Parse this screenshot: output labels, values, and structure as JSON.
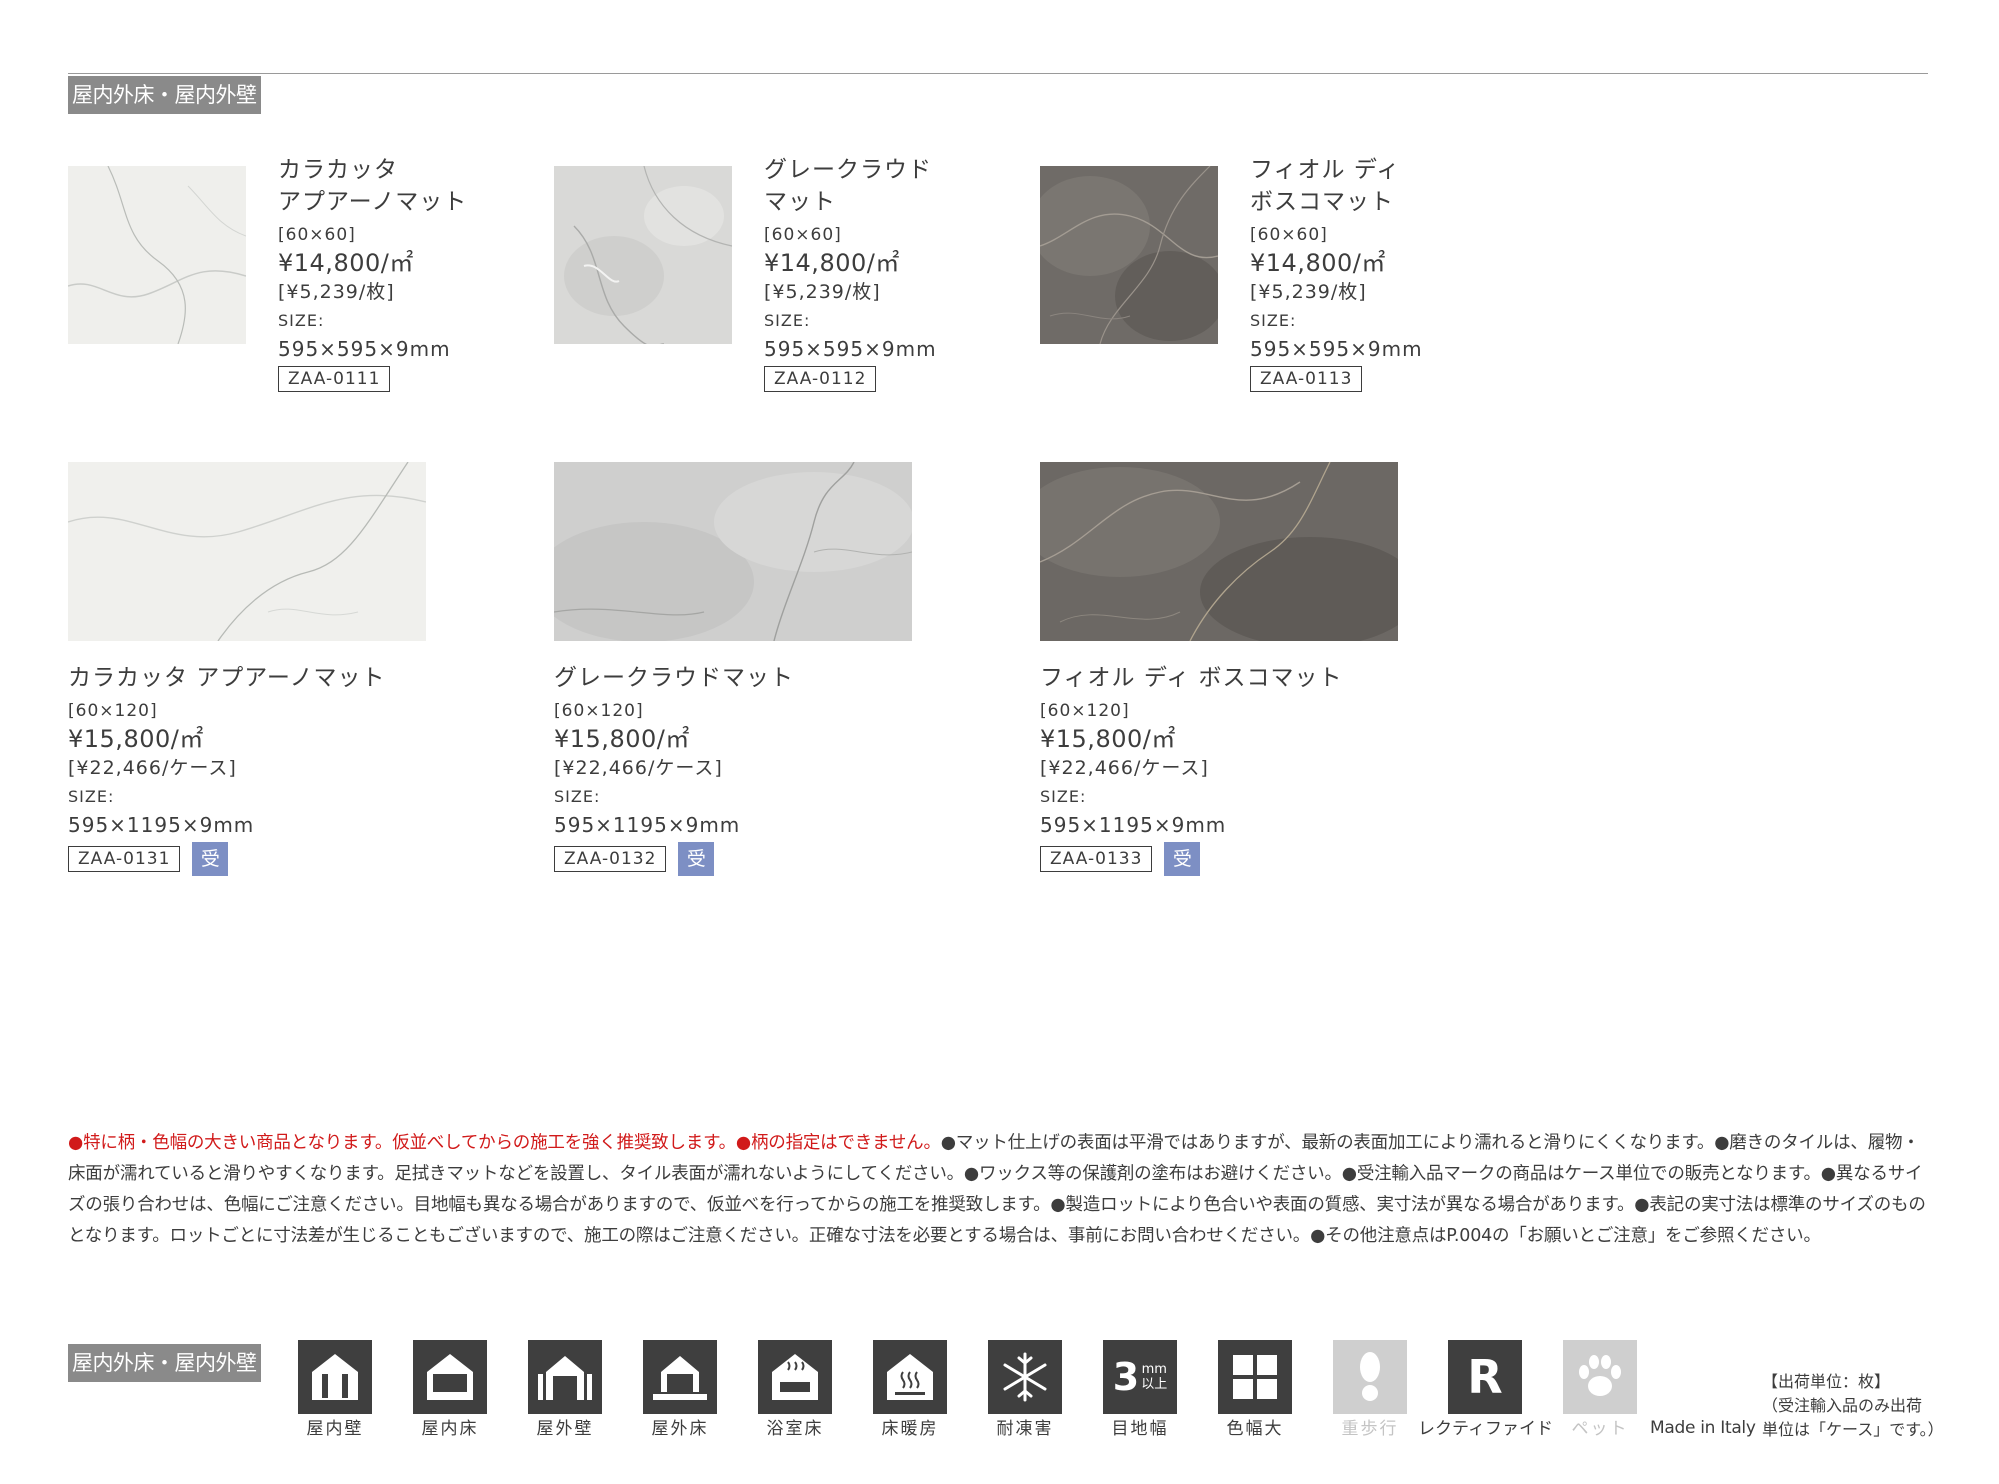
{
  "section_tag": "屋内外床・屋内外壁",
  "products_small": [
    {
      "name_line1": "カラカッタ",
      "name_line2": "アプアーノマット",
      "size_label": "[60×60]",
      "price": "¥14,800/㎡",
      "unit_price": "[¥5,239/枚]",
      "size_heading": "SIZE:",
      "dimensions": "595×595×9mm",
      "code": "ZAA-0111"
    },
    {
      "name_line1": "グレークラウド",
      "name_line2": "マット",
      "size_label": "[60×60]",
      "price": "¥14,800/㎡",
      "unit_price": "[¥5,239/枚]",
      "size_heading": "SIZE:",
      "dimensions": "595×595×9mm",
      "code": "ZAA-0112"
    },
    {
      "name_line1": "フィオル ディ",
      "name_line2": "ボスコマット",
      "size_label": "[60×60]",
      "price": "¥14,800/㎡",
      "unit_price": "[¥5,239/枚]",
      "size_heading": "SIZE:",
      "dimensions": "595×595×9mm",
      "code": "ZAA-0113"
    }
  ],
  "products_large": [
    {
      "name": "カラカッタ アプアーノマット",
      "size_label": "[60×120]",
      "price": "¥15,800/㎡",
      "unit_price": "[¥22,466/ケース]",
      "size_heading": "SIZE:",
      "dimensions": "595×1195×9mm",
      "code": "ZAA-0131",
      "badge": "受"
    },
    {
      "name": "グレークラウドマット",
      "size_label": "[60×120]",
      "price": "¥15,800/㎡",
      "unit_price": "[¥22,466/ケース]",
      "size_heading": "SIZE:",
      "dimensions": "595×1195×9mm",
      "code": "ZAA-0132",
      "badge": "受"
    },
    {
      "name": "フィオル ディ ボスコマット",
      "size_label": "[60×120]",
      "price": "¥15,800/㎡",
      "unit_price": "[¥22,466/ケース]",
      "size_heading": "SIZE:",
      "dimensions": "595×1195×9mm",
      "code": "ZAA-0133",
      "badge": "受"
    }
  ],
  "notes": {
    "warning": "●特に柄・色幅の大きい商品となります。仮並べしてからの施工を強く推奨致します。●柄の指定はできません。",
    "body": "●マット仕上げの表面は平滑ではありますが、最新の表面加工により濡れると滑りにくくなります。●磨きのタイルは、履物・床面が濡れていると滑りやすくなります。足拭きマットなどを設置し、タイル表面が濡れないようにしてください。●ワックス等の保護剤の塗布はお避けください。●受注輸入品マークの商品はケース単位での販売となります。●異なるサイズの張り合わせは、色幅にご注意ください。目地幅も異なる場合がありますので、仮並べを行ってからの施工を推奨致します。●製造ロットにより色合いや表面の質感、実寸法が異なる場合があります。●表記の実寸法は標準のサイズのものとなります。ロットごとに寸法差が生じることもございますので、施工の際はご注意ください。正確な寸法を必要とする場合は、事前にお問い合わせください。●その他注意点はP.004の「お願いとご注意」をご参照ください。"
  },
  "legend_tag": "屋内外床・屋内外壁",
  "icons": [
    {
      "icon": "indoor-wall-icon",
      "label": "屋内壁"
    },
    {
      "icon": "indoor-floor-icon",
      "label": "屋内床"
    },
    {
      "icon": "outdoor-wall-icon",
      "label": "屋外壁"
    },
    {
      "icon": "outdoor-floor-icon",
      "label": "屋外床"
    },
    {
      "icon": "bathroom-floor-icon",
      "label": "浴室床"
    },
    {
      "icon": "floor-heating-icon",
      "label": "床暖房"
    },
    {
      "icon": "frost-resistant-icon",
      "label": "耐凍害"
    },
    {
      "icon": "joint-width-icon",
      "label": "目地幅",
      "glyph_main": "3",
      "glyph_unit": "mm",
      "glyph_sub": "以上"
    },
    {
      "icon": "color-variation-icon",
      "label": "色幅大"
    },
    {
      "icon": "heavy-walking-icon",
      "label": "重歩行"
    },
    {
      "icon": "rectified-icon",
      "label": "レクティファイド",
      "glyph_main": "R"
    },
    {
      "icon": "pet-icon",
      "label": "ペット"
    }
  ],
  "made_in": "Made in Italy",
  "shipping_unit": {
    "line1": "【出荷単位：枚】",
    "line2": "（受注輸入品のみ出荷",
    "line3": "単位は「ケース」です。）"
  }
}
